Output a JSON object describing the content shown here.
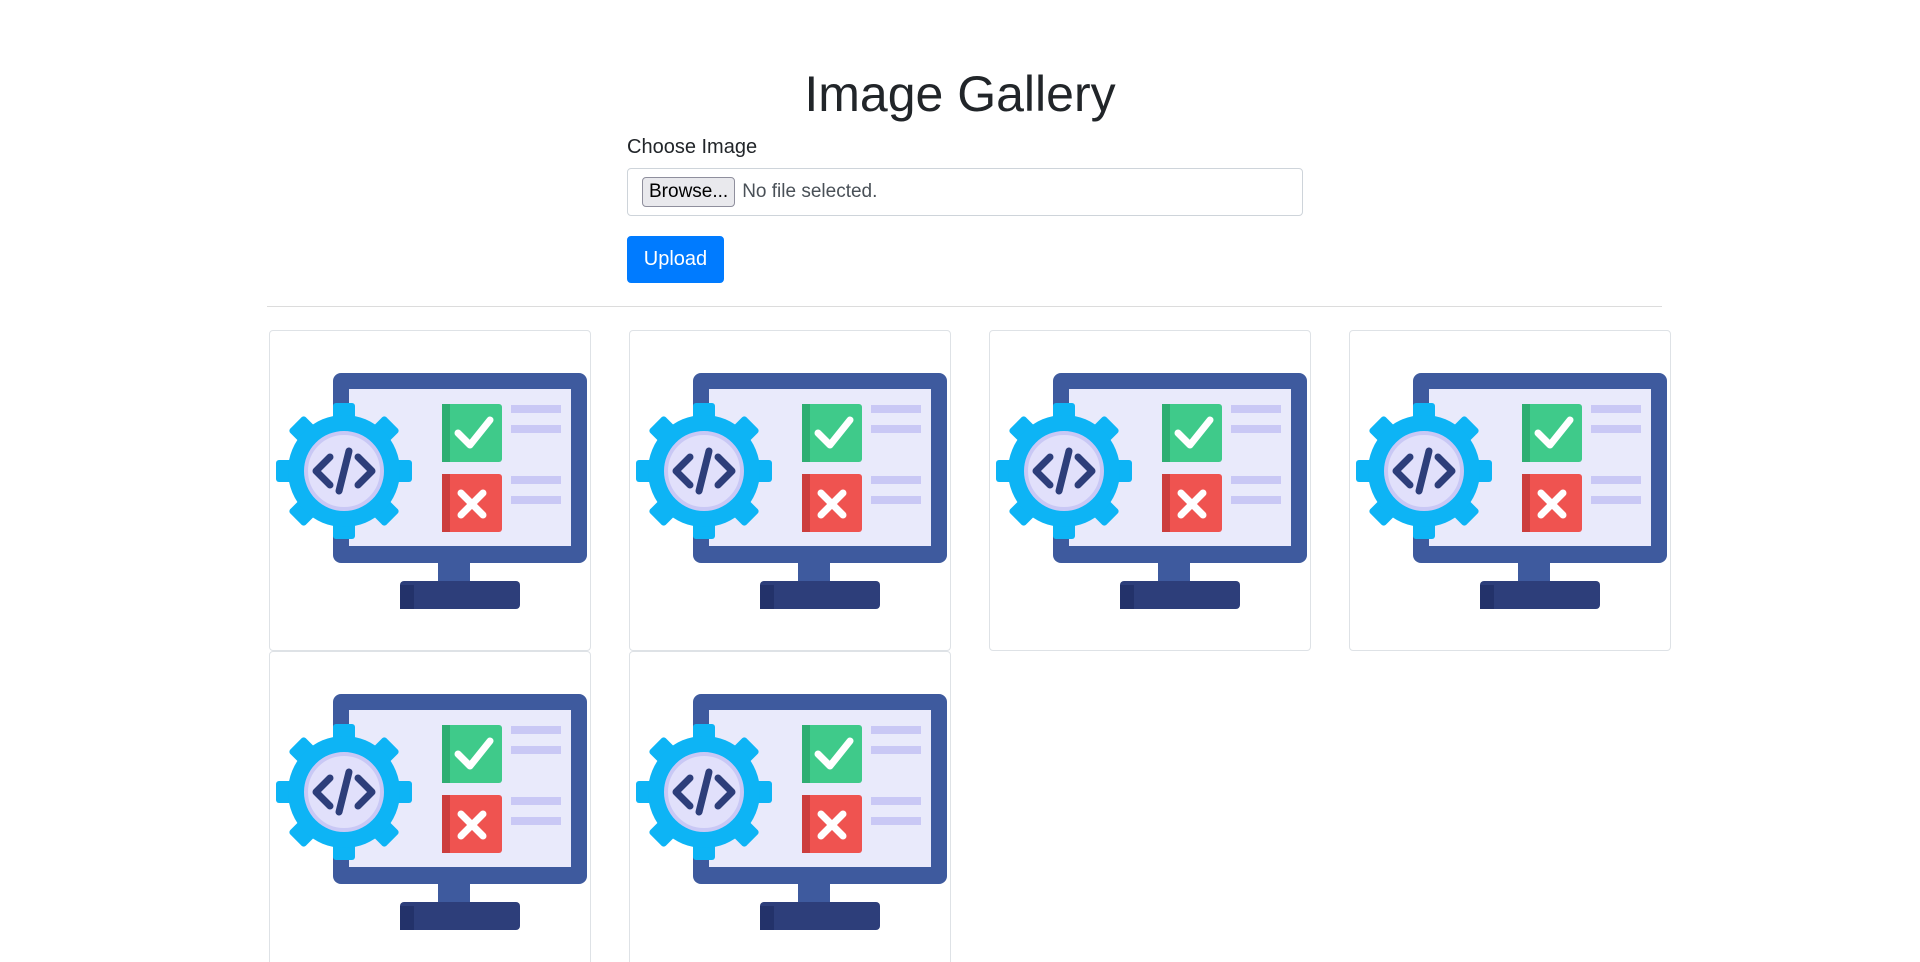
{
  "page": {
    "title": "Image Gallery"
  },
  "upload_form": {
    "label": "Choose Image",
    "browse_label": "Browse...",
    "file_status": "No file selected.",
    "upload_label": "Upload"
  },
  "gallery": {
    "image_icon": "software-testing-monitor-icon",
    "image_count": 6,
    "columns": 4
  },
  "colors": {
    "primary": "#007bff",
    "gear": "#0db4f5",
    "monitor_frame": "#3e5a9e",
    "check": "#3fca8a",
    "cross": "#ef5350"
  }
}
